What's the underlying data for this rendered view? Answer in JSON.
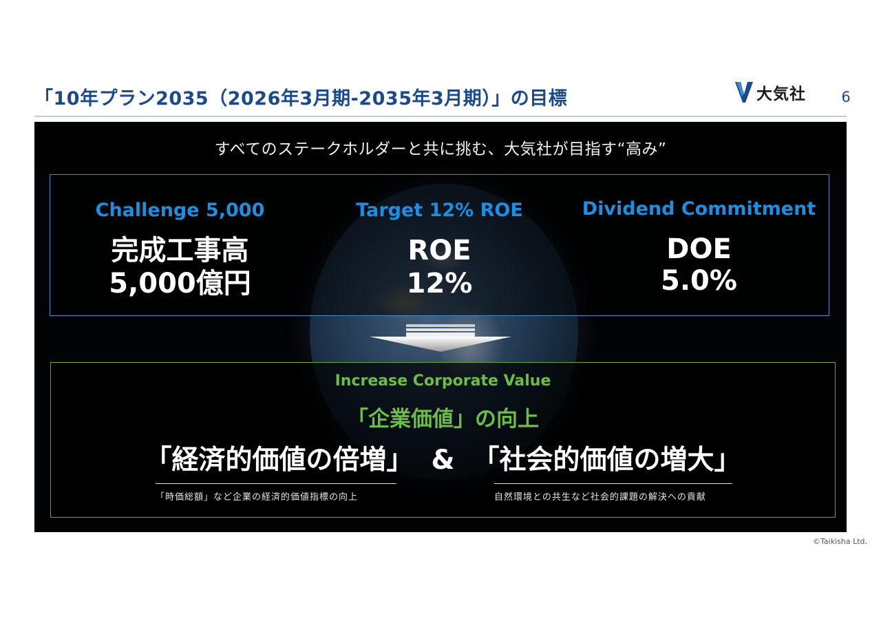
{
  "header": {
    "title": "「10年プラン2035（2026年3月期-2035年3月期）」の目標",
    "logo_text": "大気社",
    "page_number": "6"
  },
  "panel": {
    "tagline": "すべてのステークホルダーと共に挑む、大気社が目指す“高み”",
    "goals": [
      {
        "heading": "Challenge 5,000",
        "value_line1": "完成工事高",
        "value_line2": "5,000億円"
      },
      {
        "heading": "Target 12% ROE",
        "value_line1": "ROE",
        "value_line2": "12%"
      },
      {
        "heading": "Dividend Commitment",
        "value_line1": "DOE",
        "value_line2": "5.0%"
      }
    ],
    "value": {
      "en": "Increase Corporate Value",
      "ja": "「企業価値」の向上",
      "left_goal": "「経済的価値の倍増」",
      "connector": "&",
      "right_goal": "「社会的価値の増大」",
      "left_note": "「時価総額」など企業の経済的価値指標の向上",
      "right_note": "自然環境との共生など社会的課題の解決への貢献"
    }
  },
  "footer": {
    "copyright": "©Taikisha Ltd."
  },
  "colors": {
    "title": "#1a4a8e",
    "goal_heading": "#1d8ee0",
    "value_green": "#6cbd45",
    "panel_bg": "#020304"
  }
}
